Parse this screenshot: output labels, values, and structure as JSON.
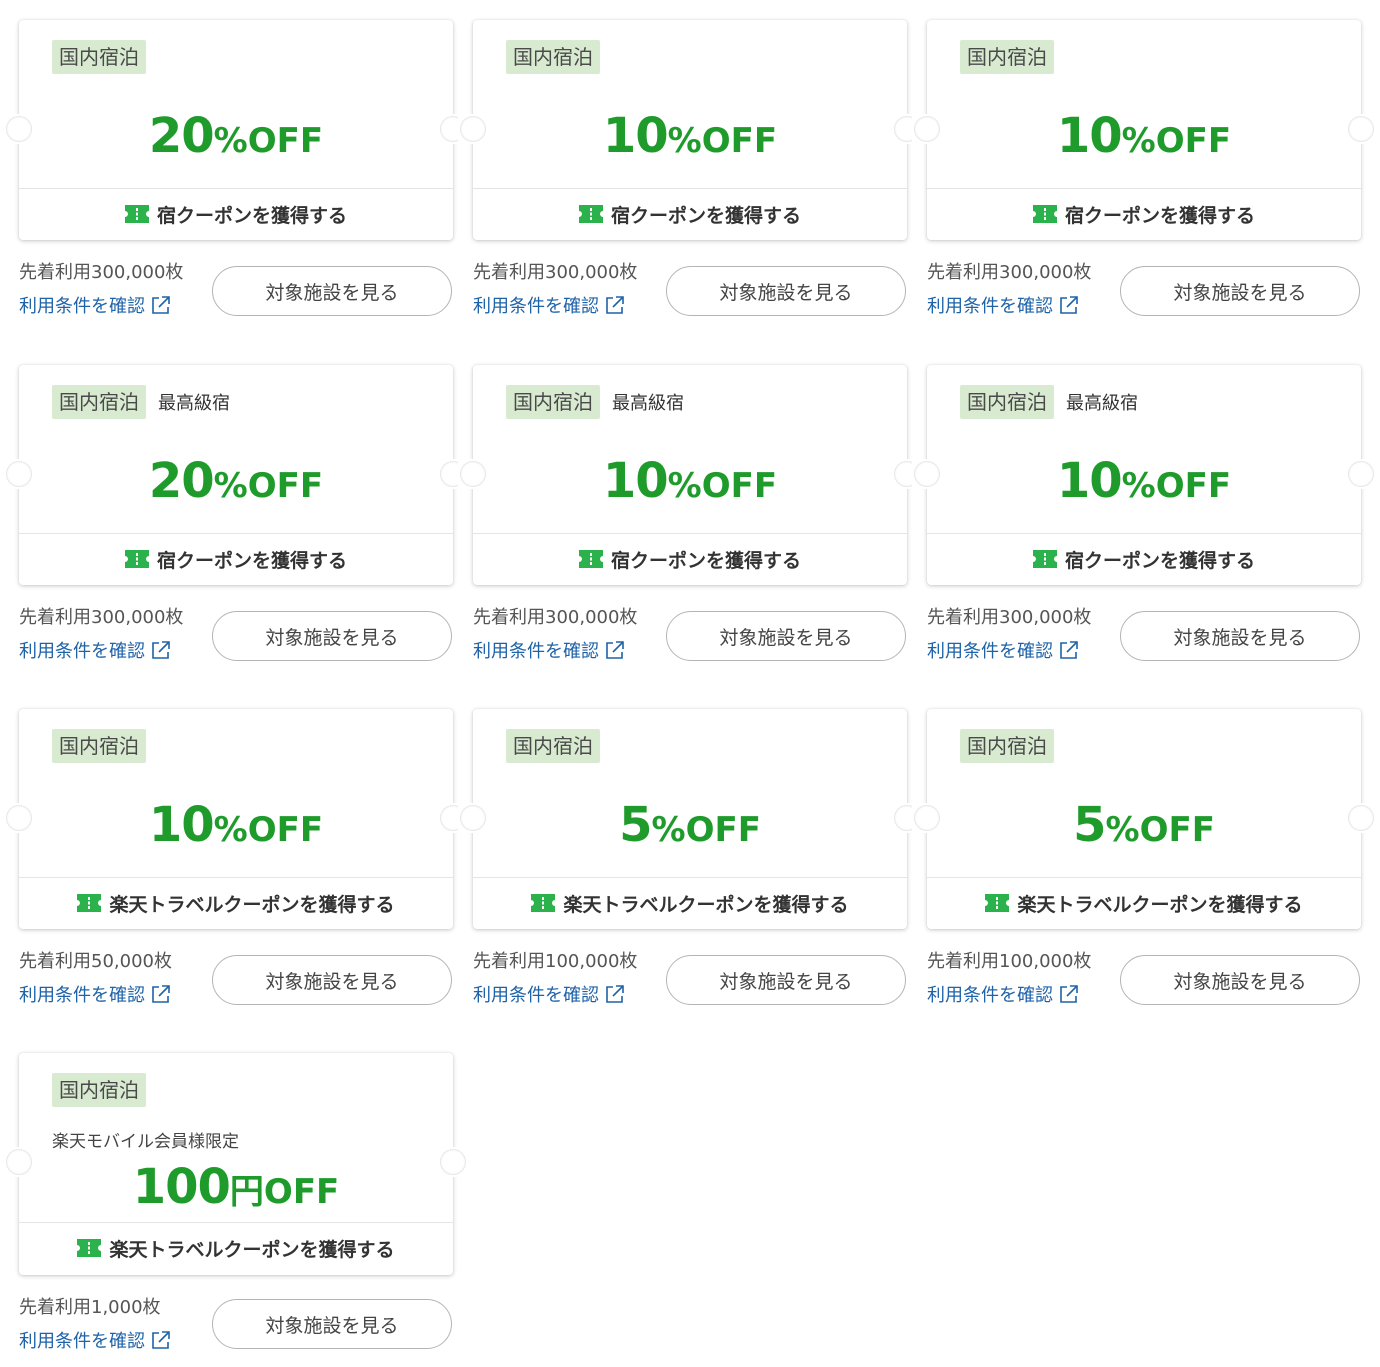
{
  "coupons": [
    {
      "category": "国内宿泊",
      "subcategory": "",
      "member_note": "",
      "amount": "20",
      "unit": "%",
      "off": "OFF",
      "cta": "宿クーポンを獲得する",
      "limit": "先着利用300,000枚",
      "terms": "利用条件を確認",
      "view_button": "対象施設を見る"
    },
    {
      "category": "国内宿泊",
      "subcategory": "",
      "member_note": "",
      "amount": "10",
      "unit": "%",
      "off": "OFF",
      "cta": "宿クーポンを獲得する",
      "limit": "先着利用300,000枚",
      "terms": "利用条件を確認",
      "view_button": "対象施設を見る"
    },
    {
      "category": "国内宿泊",
      "subcategory": "",
      "member_note": "",
      "amount": "10",
      "unit": "%",
      "off": "OFF",
      "cta": "宿クーポンを獲得する",
      "limit": "先着利用300,000枚",
      "terms": "利用条件を確認",
      "view_button": "対象施設を見る"
    },
    {
      "category": "国内宿泊",
      "subcategory": "最高級宿",
      "member_note": "",
      "amount": "20",
      "unit": "%",
      "off": "OFF",
      "cta": "宿クーポンを獲得する",
      "limit": "先着利用300,000枚",
      "terms": "利用条件を確認",
      "view_button": "対象施設を見る"
    },
    {
      "category": "国内宿泊",
      "subcategory": "最高級宿",
      "member_note": "",
      "amount": "10",
      "unit": "%",
      "off": "OFF",
      "cta": "宿クーポンを獲得する",
      "limit": "先着利用300,000枚",
      "terms": "利用条件を確認",
      "view_button": "対象施設を見る"
    },
    {
      "category": "国内宿泊",
      "subcategory": "最高級宿",
      "member_note": "",
      "amount": "10",
      "unit": "%",
      "off": "OFF",
      "cta": "宿クーポンを獲得する",
      "limit": "先着利用300,000枚",
      "terms": "利用条件を確認",
      "view_button": "対象施設を見る"
    },
    {
      "category": "国内宿泊",
      "subcategory": "",
      "member_note": "",
      "amount": "10",
      "unit": "%",
      "off": "OFF",
      "cta": "楽天トラベルクーポンを獲得する",
      "limit": "先着利用50,000枚",
      "terms": "利用条件を確認",
      "view_button": "対象施設を見る"
    },
    {
      "category": "国内宿泊",
      "subcategory": "",
      "member_note": "",
      "amount": "5",
      "unit": "%",
      "off": "OFF",
      "cta": "楽天トラベルクーポンを獲得する",
      "limit": "先着利用100,000枚",
      "terms": "利用条件を確認",
      "view_button": "対象施設を見る"
    },
    {
      "category": "国内宿泊",
      "subcategory": "",
      "member_note": "",
      "amount": "5",
      "unit": "%",
      "off": "OFF",
      "cta": "楽天トラベルクーポンを獲得する",
      "limit": "先着利用100,000枚",
      "terms": "利用条件を確認",
      "view_button": "対象施設を見る"
    },
    {
      "category": "国内宿泊",
      "subcategory": "",
      "member_note": "楽天モバイル会員様限定",
      "amount": "100",
      "unit": "円",
      "off": "OFF",
      "cta": "楽天トラベルクーポンを獲得する",
      "limit": "先着利用1,000枚",
      "terms": "利用条件を確認",
      "view_button": "対象施設を見る"
    }
  ],
  "icons": {
    "cta": "ticket-icon",
    "terms": "external-link-icon"
  },
  "colors": {
    "discount": "#1f9b2c",
    "tag_bg": "#d8ebd0",
    "link": "#1e62a8",
    "icon": "#2bb24c"
  }
}
